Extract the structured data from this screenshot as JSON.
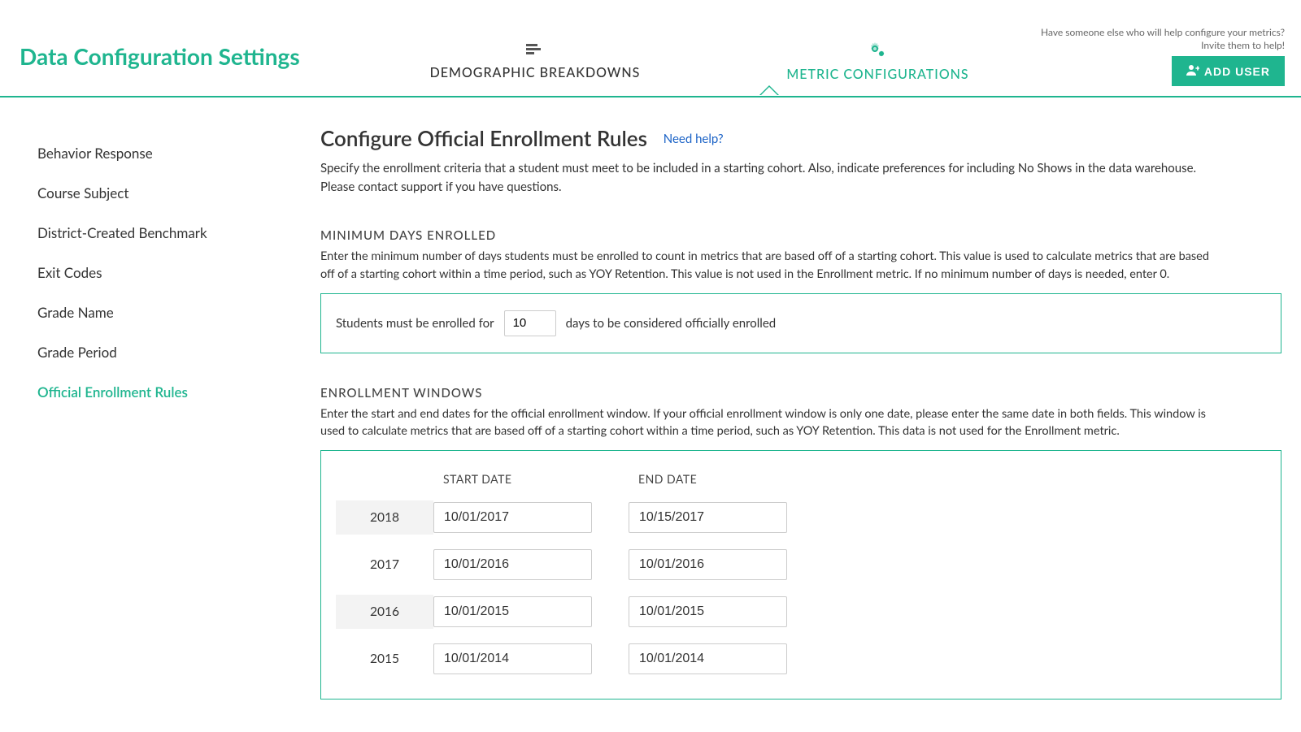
{
  "header": {
    "page_title": "Data Configuration Settings",
    "tabs": [
      {
        "label": "DEMOGRAPHIC BREAKDOWNS",
        "active": false
      },
      {
        "label": "METRIC CONFIGURATIONS",
        "active": true
      }
    ],
    "invite_text": "Have someone else who will help configure your metrics? Invite them to help!",
    "add_user_label": "ADD USER"
  },
  "sidebar": {
    "items": [
      {
        "label": "Behavior Response",
        "active": false
      },
      {
        "label": "Course Subject",
        "active": false
      },
      {
        "label": "District-Created Benchmark",
        "active": false
      },
      {
        "label": "Exit Codes",
        "active": false
      },
      {
        "label": "Grade Name",
        "active": false
      },
      {
        "label": "Grade Period",
        "active": false
      },
      {
        "label": "Official Enrollment Rules",
        "active": true
      }
    ]
  },
  "main": {
    "title": "Configure Official Enrollment Rules",
    "help_link": "Need help?",
    "description": "Specify the enrollment criteria that a student must meet to be included in a starting cohort. Also, indicate preferences for including No Shows in the data warehouse. Please contact support if you have questions.",
    "min_days": {
      "heading": "MINIMUM DAYS ENROLLED",
      "description": "Enter the minimum number of days students must be enrolled to count in metrics that are based off of a starting cohort. This value is used to calculate metrics that are based off of a starting cohort within a time period, such as YOY Retention. This value is not used in the Enrollment metric. If no minimum number of days is needed, enter 0.",
      "prefix": "Students must be enrolled for",
      "value": "10",
      "suffix": "days to be considered officially enrolled"
    },
    "windows": {
      "heading": "ENROLLMENT WINDOWS",
      "description": "Enter the start and end dates for the official enrollment window. If your official enrollment window is only one date, please enter the same date in both fields. This window is used to calculate metrics that are based off of a starting cohort within a time period, such as YOY Retention. This data is not used for the Enrollment metric.",
      "columns": {
        "start": "START DATE",
        "end": "END DATE"
      },
      "rows": [
        {
          "year": "2018",
          "start": "10/01/2017",
          "end": "10/15/2017"
        },
        {
          "year": "2017",
          "start": "10/01/2016",
          "end": "10/01/2016"
        },
        {
          "year": "2016",
          "start": "10/01/2015",
          "end": "10/01/2015"
        },
        {
          "year": "2015",
          "start": "10/01/2014",
          "end": "10/01/2014"
        }
      ]
    }
  }
}
